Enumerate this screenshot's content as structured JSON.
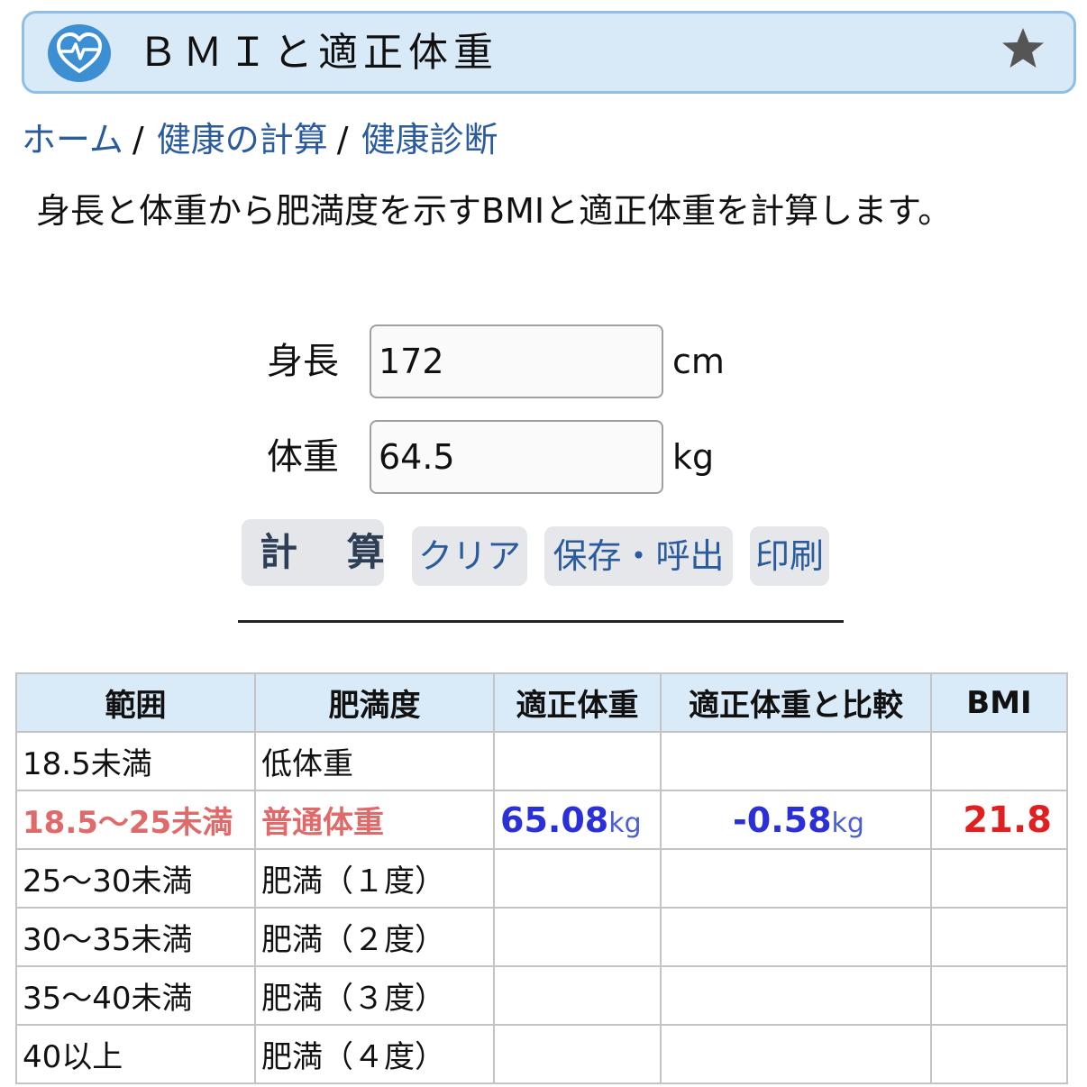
{
  "header": {
    "title": "ＢＭＩと適正体重",
    "logo_icon": "heart-pulse-icon",
    "favorite_icon": "star-icon",
    "colors": {
      "bar_bg": "#d8e9f8",
      "bar_border": "#8fbfe6",
      "logo": "#3d8fd4"
    }
  },
  "breadcrumb": {
    "items": [
      "ホーム",
      "健康の計算",
      "健康診断"
    ],
    "separator": "/"
  },
  "description": "身長と体重から肥満度を示すBMIと適正体重を計算します。",
  "form": {
    "height": {
      "label": "身長",
      "value": "172",
      "unit": "cm"
    },
    "weight": {
      "label": "体重",
      "value": "64.5",
      "unit": "kg"
    }
  },
  "buttons": {
    "calculate": "計 算",
    "clear": "クリア",
    "save_load": "保存・呼出",
    "print": "印刷"
  },
  "table": {
    "headers": [
      "範囲",
      "肥満度",
      "適正体重",
      "適正体重と比較",
      "BMI"
    ],
    "rows": [
      {
        "range": "18.5未満",
        "category": "低体重"
      },
      {
        "range": "18.5〜25未満",
        "category": "普通体重",
        "standard_weight": "65.08",
        "standard_unit": "kg",
        "difference": "-0.58",
        "difference_unit": "kg",
        "bmi": "21.8"
      },
      {
        "range": "25〜30未満",
        "category": "肥満（１度）"
      },
      {
        "range": "30〜35未満",
        "category": "肥満（２度）"
      },
      {
        "range": "35〜40未満",
        "category": "肥満（３度）"
      },
      {
        "range": "40以上",
        "category": "肥満（４度）"
      }
    ],
    "colors": {
      "highlight_text": "#e06a6a",
      "value_blue": "#2b2fd8",
      "bmi_red": "#e02020",
      "header_bg": "#d9eaf8"
    }
  }
}
